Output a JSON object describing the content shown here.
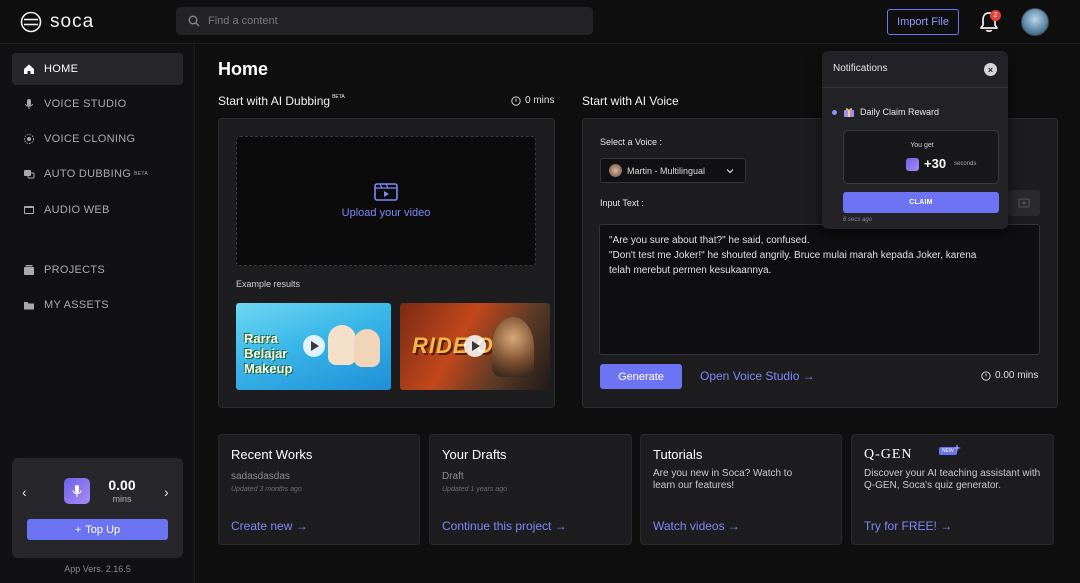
{
  "app": {
    "logo_text": "soca"
  },
  "search": {
    "placeholder": "Find a content"
  },
  "header": {
    "import_label": "Import File",
    "notification_count": "2"
  },
  "sidebar": {
    "items": [
      {
        "label": "HOME"
      },
      {
        "label": "VOICE STUDIO"
      },
      {
        "label": "VOICE CLONING"
      },
      {
        "label": "AUTO DUBBING",
        "badge": "BETA"
      },
      {
        "label": "AUDIO WEB"
      },
      {
        "label": "PROJECTS"
      },
      {
        "label": "MY ASSETS"
      }
    ],
    "credit": {
      "amount": "0.00",
      "unit": "mins",
      "topup_label": "Top Up"
    },
    "version": "App Vers. 2.16.5"
  },
  "main": {
    "title": "Home",
    "dubbing": {
      "title": "Start with AI Dubbing",
      "badge": "BETA",
      "mins": "0 mins",
      "upload_label": "Upload your video",
      "example_label": "Example results",
      "thumb1_text": [
        "Rarra",
        "Belajar",
        "Makeup"
      ],
      "thumb2_text": "RIDE ON"
    },
    "voice": {
      "title": "Start with AI Voice",
      "select_label": "Select a Voice :",
      "selected_voice": "Martin - Multilingual",
      "input_label": "Input Text :",
      "input_lines": [
        "\"Are you sure about that?\" he said, confused.",
        "\"Don't test me Joker!\" he shouted angrily. Bruce mulai marah kepada Joker, karena",
        "telah merebut permen kesukaannya."
      ],
      "generate_label": "Generate",
      "open_studio_label": "Open Voice Studio →",
      "mins": "0.00 mins"
    },
    "cards": [
      {
        "title": "Recent Works",
        "sub": "sadasdasdas",
        "meta": "Updated 3 months ago",
        "link": "Create new →"
      },
      {
        "title": "Your Drafts",
        "sub": "Draft",
        "meta": "Updated 1 years ago",
        "link": "Continue this project →"
      },
      {
        "title": "Tutorials",
        "desc": "Are you new in Soca? Watch to learn our features!",
        "link": "Watch videos →"
      },
      {
        "title": "Q-GEN",
        "badge": "NEW",
        "desc": "Discover your AI teaching assistant with Q-GEN, Soca's quiz generator.",
        "link": "Try for FREE! →"
      }
    ]
  },
  "notifications": {
    "title": "Notifications",
    "item_title": "Daily Claim Reward",
    "reward_top": "You get",
    "reward_amount": "+30",
    "reward_unit": "seconds",
    "claim_label": "CLAIM",
    "time": "6 secs ago"
  },
  "colors": {
    "accent": "#6c74f4",
    "link": "#7f88f6",
    "background": "#0f0f10",
    "panel": "#1d1d20"
  }
}
